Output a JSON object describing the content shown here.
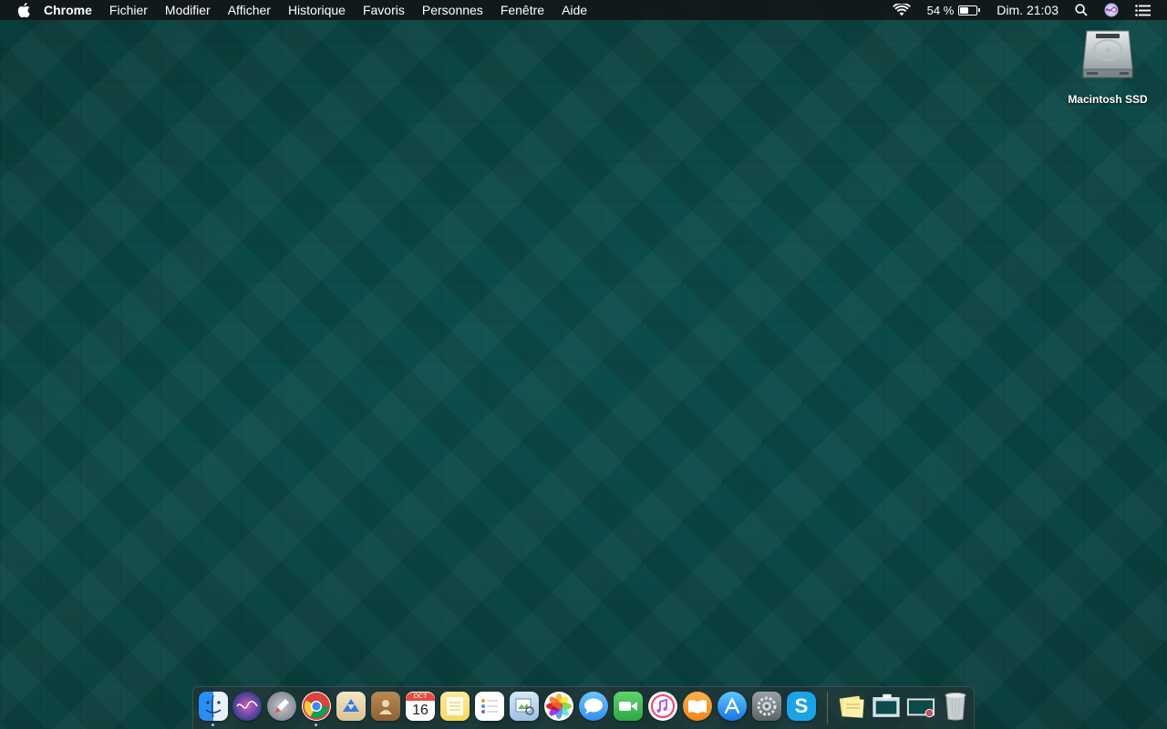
{
  "menubar": {
    "app_name": "Chrome",
    "menus": [
      "Fichier",
      "Modifier",
      "Afficher",
      "Historique",
      "Favoris",
      "Personnes",
      "Fenêtre",
      "Aide"
    ],
    "battery_percent_label": "54 %",
    "battery_level": 0.54,
    "clock": "Dim. 21:03"
  },
  "desktop": {
    "drive_label": "Macintosh SSD"
  },
  "dock": {
    "calendar_month": "OCT",
    "calendar_day": "16",
    "apps": [
      {
        "name": "finder",
        "color": "#2a8ff5"
      },
      {
        "name": "siri",
        "color": "#3a3f8c"
      },
      {
        "name": "launchpad",
        "color": "#8a9299"
      },
      {
        "name": "chrome",
        "color": "#ffffff"
      },
      {
        "name": "mail",
        "color": "#3a78d8"
      },
      {
        "name": "contacts",
        "color": "#a87a4a"
      },
      {
        "name": "calendar",
        "color": "#ffffff"
      },
      {
        "name": "notes",
        "color": "#f8e38a"
      },
      {
        "name": "reminders",
        "color": "#ffffff"
      },
      {
        "name": "preview",
        "color": "#9cc0e6"
      },
      {
        "name": "photos",
        "color": "#ffffff"
      },
      {
        "name": "messages",
        "color": "#4fb0f5"
      },
      {
        "name": "facetime",
        "color": "#3fbe55"
      },
      {
        "name": "itunes",
        "color": "#ffffff"
      },
      {
        "name": "ibooks",
        "color": "#f39a2e"
      },
      {
        "name": "app-store",
        "color": "#2e8df1"
      },
      {
        "name": "system-preferences",
        "color": "#7a8084"
      },
      {
        "name": "skype",
        "color": "#1aa4e8"
      }
    ],
    "right_items": [
      "stickies",
      "documents-folder",
      "downloads-folder",
      "trash"
    ]
  }
}
